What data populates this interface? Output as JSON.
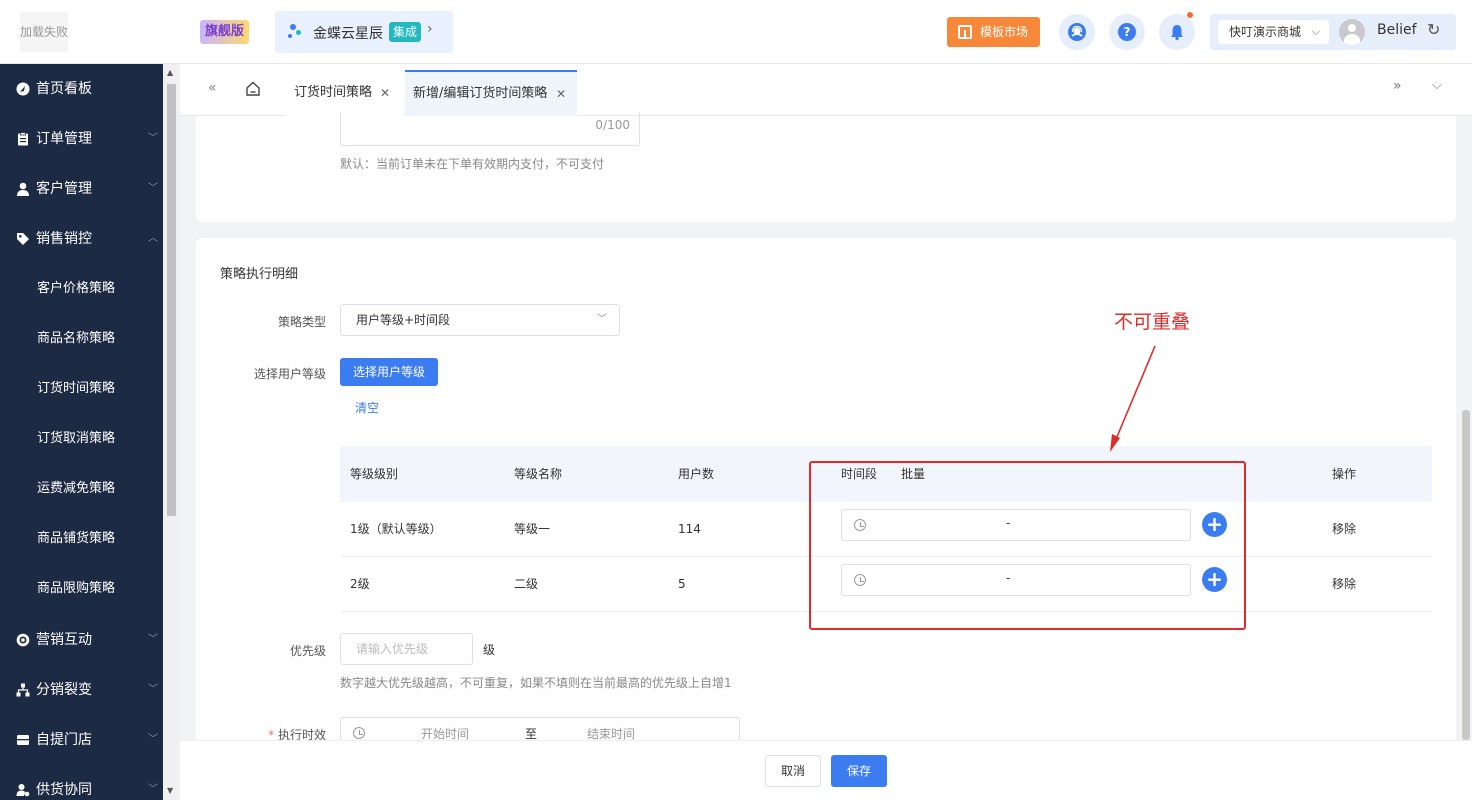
{
  "header": {
    "logo_text": "加载失败",
    "edition_badge": "旗舰版",
    "brand_name": "金蝶云星辰",
    "brand_tag": "集成",
    "market_button": "模板市场",
    "help_glyph": "?",
    "store_select": "快叮演示商城",
    "user_name": "Belief",
    "brand_dot_colors": [
      "#3b7cf0",
      "#24b8c2",
      "#f7883a"
    ],
    "market_color": "#f7883a"
  },
  "sidebar": {
    "items": [
      {
        "label": "首页看板",
        "icon": "dashboard-icon"
      },
      {
        "label": "订单管理",
        "icon": "clipboard-icon"
      },
      {
        "label": "客户管理",
        "icon": "user-icon"
      },
      {
        "label": "销售销控",
        "icon": "tag-icon",
        "expanded": true
      }
    ],
    "sub_items": [
      "客户价格策略",
      "商品名称策略",
      "订货时间策略",
      "订货取消策略",
      "运费减免策略",
      "商品铺货策略",
      "商品限购策略"
    ],
    "bottom_items": [
      {
        "label": "营销互动",
        "icon": "target-icon"
      },
      {
        "label": "分销裂变",
        "icon": "network-icon"
      },
      {
        "label": "自提门店",
        "icon": "store-icon"
      },
      {
        "label": "供货协同",
        "icon": "user-gear-icon"
      }
    ],
    "background": "#1d2a43"
  },
  "tabs": {
    "items": [
      {
        "label": "订货时间策略",
        "active": false
      },
      {
        "label": "新增/编辑订货时间策略",
        "active": true
      }
    ]
  },
  "card1": {
    "counter": "0/100",
    "hint": "默认：当前订单未在下单有效期内支付，不可支付"
  },
  "detail": {
    "section_title": "策略执行明细",
    "strategy_type_label": "策略类型",
    "strategy_type_value": "用户等级+时间段",
    "user_level_label": "选择用户等级",
    "user_level_button": "选择用户等级",
    "clear_link": "清空",
    "table": {
      "headers": {
        "level": "等级级别",
        "name": "等级名称",
        "users": "用户数",
        "period": "时间段",
        "batch": "批量",
        "ops": "操作"
      },
      "rows": [
        {
          "level": "1级（默认等级）",
          "name": "等级一",
          "users": "114",
          "range_sep": "-",
          "remove": "移除"
        },
        {
          "level": "2级",
          "name": "二级",
          "users": "5",
          "range_sep": "-",
          "remove": "移除"
        }
      ]
    },
    "priority_label": "优先级",
    "priority_placeholder": "请输入优先级",
    "priority_unit": "级",
    "priority_hint": "数字越大优先级越高，不可重复，如果不填则在当前最高的优先级上自增1",
    "exec_label": "执行时效",
    "exec_required": "*",
    "exec_start": "开始时间",
    "exec_to": "至",
    "exec_end": "结束时间"
  },
  "annotation": {
    "text": "不可重叠",
    "color": "#e02b2b"
  },
  "footer": {
    "cancel": "取消",
    "save": "保存"
  },
  "accent_color": "#3b7cf0"
}
